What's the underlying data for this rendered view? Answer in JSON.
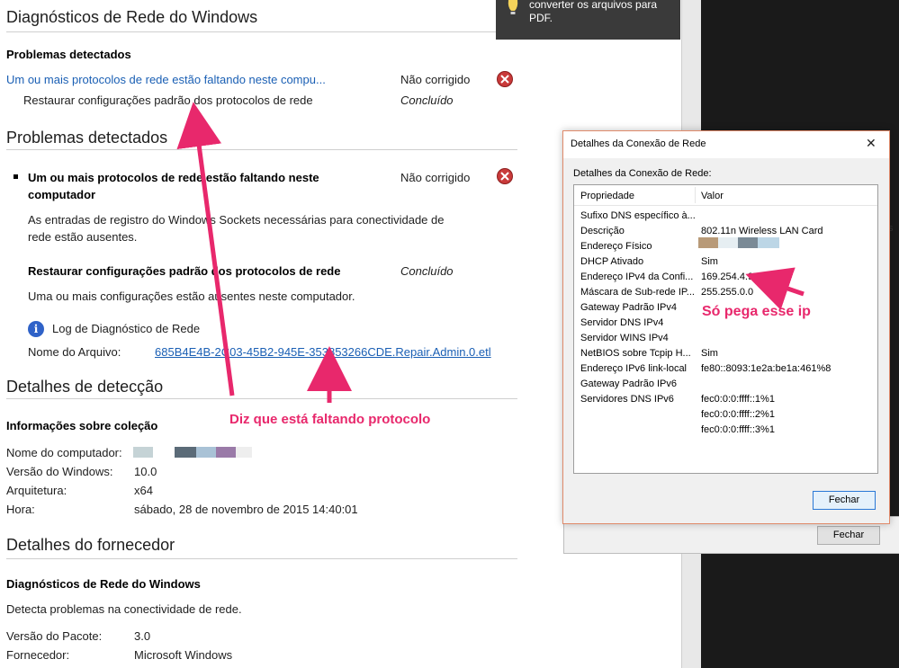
{
  "report": {
    "title": "Diagnósticos de Rede do Windows",
    "summary": {
      "heading": "Problemas detectados",
      "problem_link": "Um ou mais protocolos de rede estão faltando neste compu...",
      "problem_status": "Não corrigido",
      "fix_label": "Restaurar configurações padrão dos protocolos de rede",
      "fix_status": "Concluído"
    },
    "detail": {
      "heading": "Problemas detectados",
      "problem_title_line1": "Um ou mais protocolos de rede estão faltando neste",
      "problem_title_line2": "computador",
      "problem_status": "Não corrigido",
      "problem_desc_line1": "As entradas de registro do Windows Sockets necessárias para conectividade de",
      "problem_desc_line2": "rede estão ausentes.",
      "fix_title": "Restaurar configurações padrão dos protocolos de rede",
      "fix_status": "Concluído",
      "fix_desc": "Uma ou mais configurações estão ausentes neste computador.",
      "log_label": "Log de Diagnóstico de Rede",
      "file_label": "Nome do Arquivo:",
      "file_name": "685B4E4B-2C03-45B2-945E-353853266CDE.Repair.Admin.0.etl"
    },
    "detection": {
      "heading": "Detalhes de detecção",
      "subheading": "Informações sobre coleção",
      "rows": [
        {
          "label": "Nome do computador:",
          "value": ""
        },
        {
          "label": "Versão do Windows:",
          "value": "10.0"
        },
        {
          "label": "Arquitetura:",
          "value": "x64"
        },
        {
          "label": "Hora:",
          "value": "sábado, 28 de novembro de 2015 14:40:01"
        }
      ],
      "redaction_colors": [
        "#c5d3d6",
        "#5b6b78",
        "#a9c2d6",
        "#9a7aa8",
        "#eeeeee"
      ]
    },
    "vendor": {
      "heading": "Detalhes do fornecedor",
      "subheading": "Diagnósticos de Rede do Windows",
      "desc": "Detecta problemas na conectividade de rede.",
      "rows": [
        {
          "label": "Versão do Pacote:",
          "value": "3.0"
        },
        {
          "label": "Fornecedor:",
          "value": "Microsoft Windows"
        }
      ]
    }
  },
  "toast": {
    "line1": "converter os arquivos para",
    "line2": "PDF."
  },
  "background_dialog": {
    "button": "Fechar"
  },
  "dialog": {
    "title": "Detalhes da Conexão de Rede",
    "close_glyph": "✕",
    "group_label": "Detalhes da Conexão de Rede:",
    "columns": [
      "Propriedade",
      "Valor"
    ],
    "rows": [
      {
        "prop": "Sufixo DNS específico à...",
        "value": ""
      },
      {
        "prop": "Descrição",
        "value": "802.11n Wireless LAN Card"
      },
      {
        "prop": "Endereço Físico",
        "value": ""
      },
      {
        "prop": "DHCP Ativado",
        "value": "Sim"
      },
      {
        "prop": "Endereço IPv4 da Confi...",
        "value": "169.254.4.97"
      },
      {
        "prop": "Máscara de Sub-rede IP...",
        "value": "255.255.0.0"
      },
      {
        "prop": "Gateway Padrão IPv4",
        "value": ""
      },
      {
        "prop": "Servidor DNS IPv4",
        "value": ""
      },
      {
        "prop": "Servidor WINS IPv4",
        "value": ""
      },
      {
        "prop": "NetBIOS sobre Tcpip H...",
        "value": "Sim"
      },
      {
        "prop": "Endereço IPv6 link-local",
        "value": "fe80::8093:1e2a:be1a:461%8"
      },
      {
        "prop": "Gateway Padrão IPv6",
        "value": ""
      },
      {
        "prop": "Servidores DNS IPv6",
        "value": "fec0:0:0:ffff::1%1"
      },
      {
        "prop": "",
        "value": "fec0:0:0:ffff::2%1"
      },
      {
        "prop": "",
        "value": "fec0:0:0:ffff::3%1"
      }
    ],
    "mac_colors": [
      "#b89a78",
      "#e6eef2",
      "#7a8a96",
      "#bcd6e6"
    ],
    "button": "Fechar"
  },
  "annotations": {
    "missing_protocol": "Diz que está faltando protocolo",
    "only_ip": "Só pega esse ip",
    "color": "#e8286c"
  }
}
